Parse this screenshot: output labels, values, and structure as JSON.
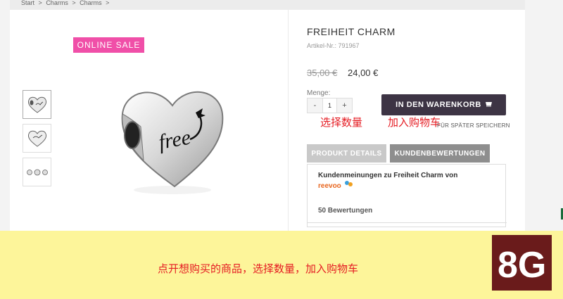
{
  "breadcrumb": [
    "Start",
    ">",
    "Charms",
    ">",
    "Charms",
    ">"
  ],
  "badge": "ONLINE SALE",
  "product": {
    "title": "FREIHEIT CHARM",
    "sku_label": "Artikel-Nr.:",
    "sku": "791967",
    "old_price": "35,00 €",
    "price": "24,00 €",
    "engraving": "free"
  },
  "quantity": {
    "label": "Menge:",
    "minus": "-",
    "value": "1",
    "plus": "+"
  },
  "cart_button": "IN DEN WARENKORB",
  "save_later": "FÜR SPÄTER SPEICHERN",
  "annotations": {
    "quantity": "选择数量",
    "cart": "加入购物车",
    "footer": "点开想购买的商品，选择数量，加入购物车"
  },
  "tabs": [
    "PRODUKT DETAILS",
    "KUNDENBEWERTUNGEN"
  ],
  "reviews": {
    "heading": "Kundenmeinungen zu Freiheit Charm von",
    "provider": "reevoo",
    "count": "50 Bewertungen"
  },
  "logo_text": "8G",
  "colors": {
    "badge": "#f04fa8",
    "cart_button": "#3d3444",
    "annotation": "#e51c23",
    "footer_bg": "#fdf59a",
    "logo_bg": "#6a1b1b"
  }
}
